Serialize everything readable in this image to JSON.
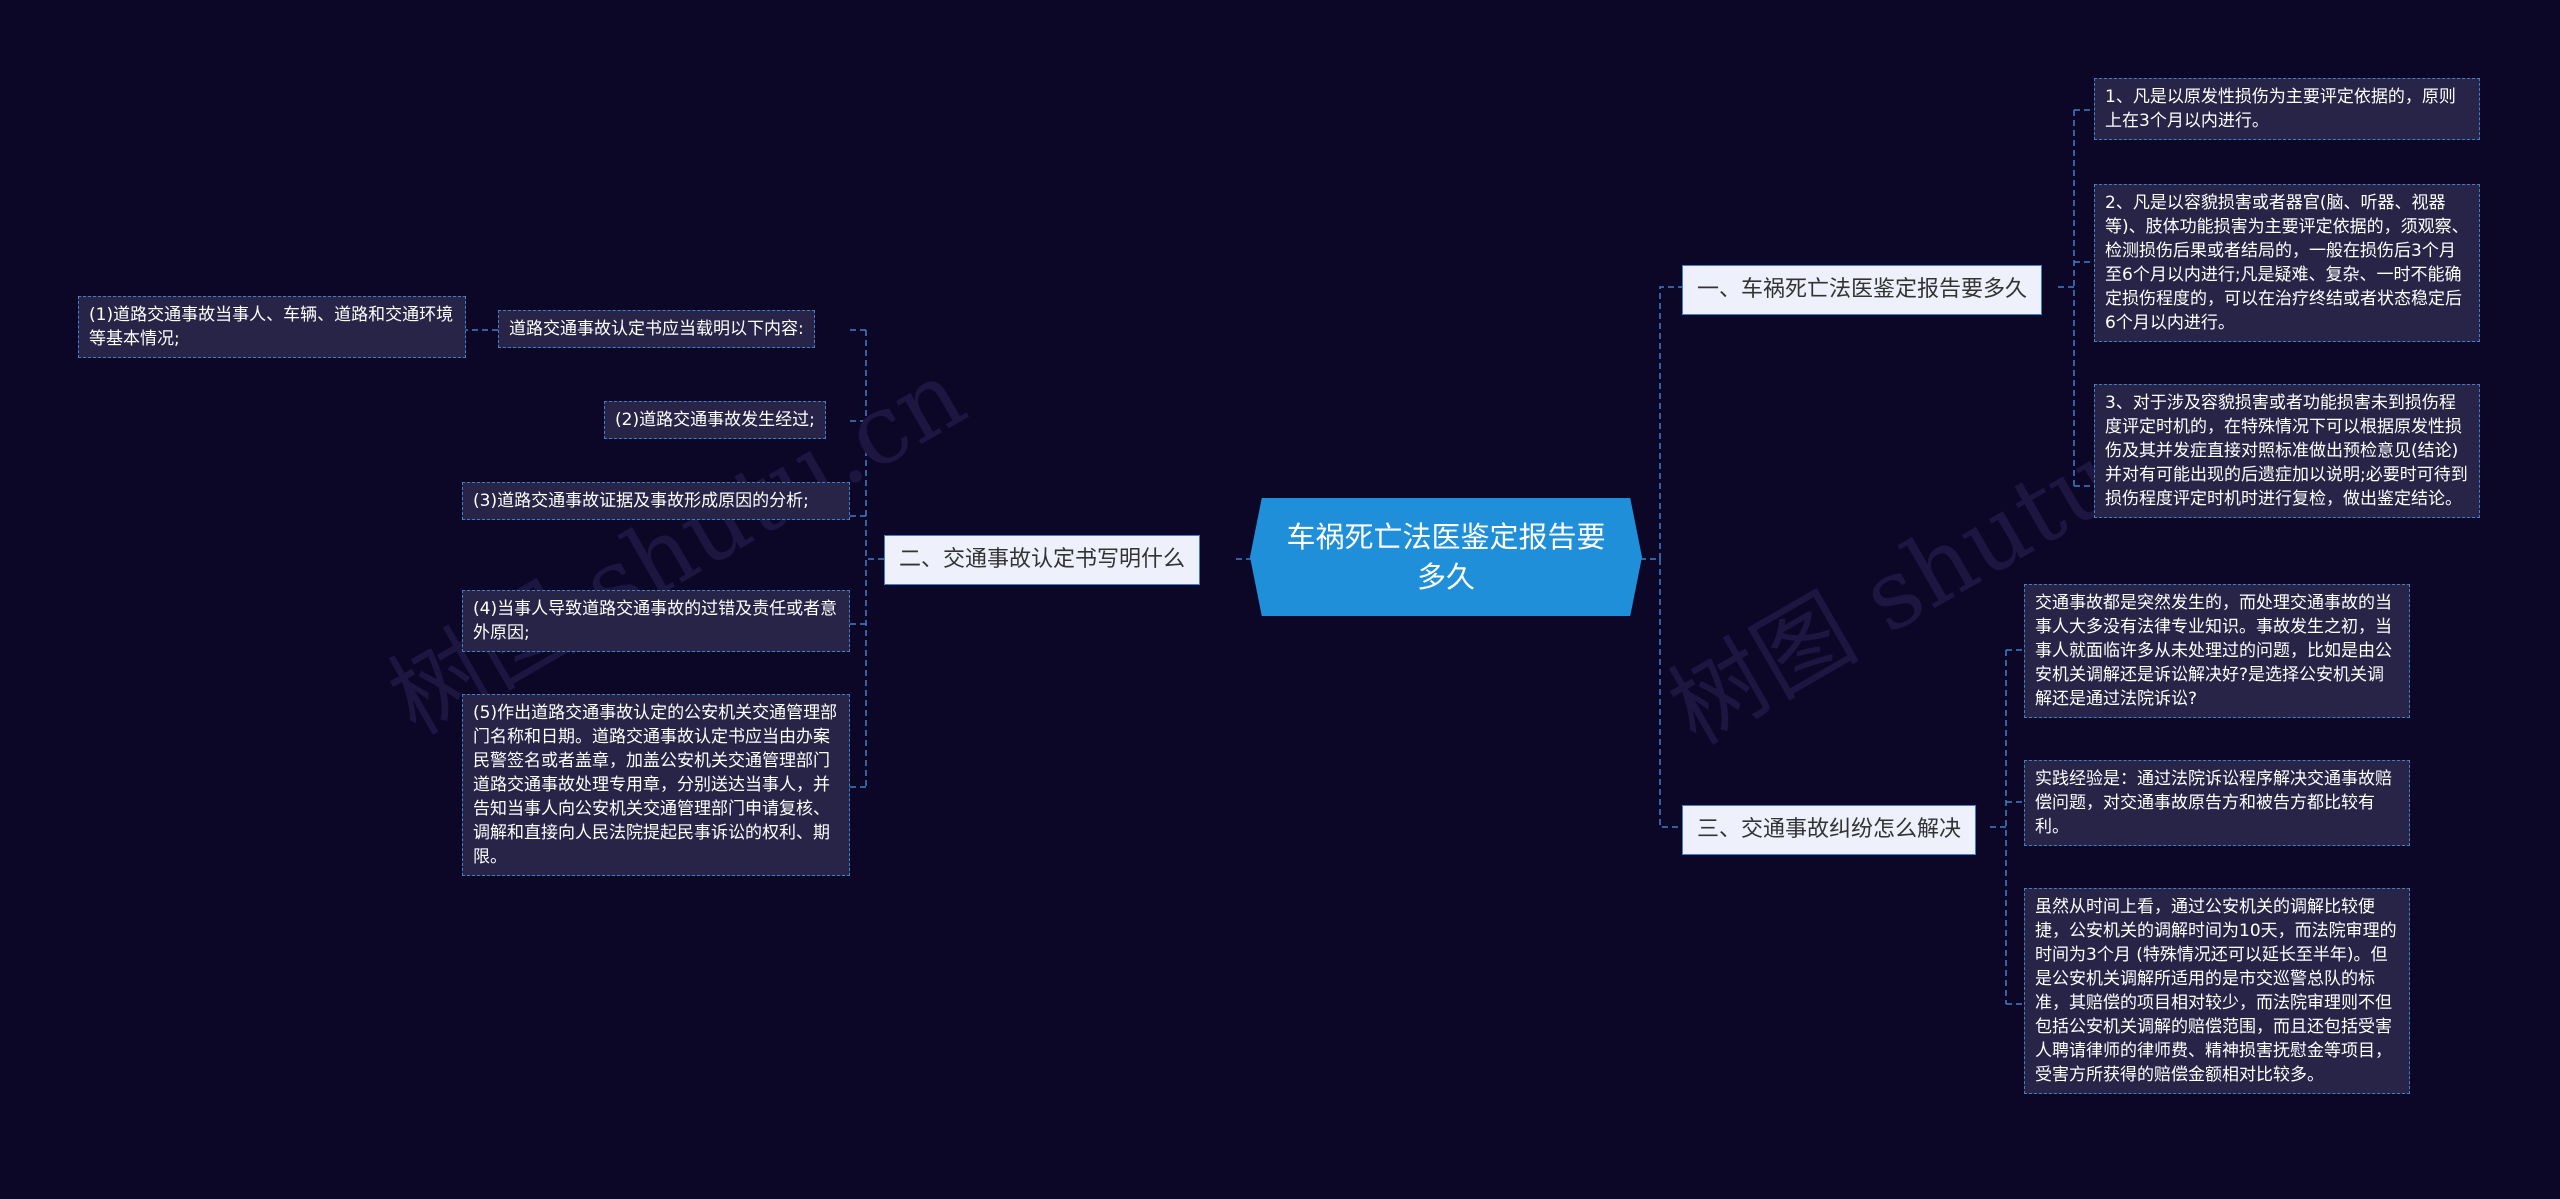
{
  "watermarks": [
    "树图 shutu.cn",
    "树图 shutu.cn"
  ],
  "root": {
    "label": "车祸死亡法医鉴定报告要多久"
  },
  "right_top": {
    "label": "一、车祸死亡法医鉴定报告要多久",
    "items": [
      "1、凡是以原发性损伤为主要评定依据的，原则上在3个月以内进行。",
      "2、凡是以容貌损害或者器官(脑、听器、视器等)、肢体功能损害为主要评定依据的，须观察、检测损伤后果或者结局的，一般在损伤后3个月至6个月以内进行;凡是疑难、复杂、一时不能确定损伤程度的，可以在治疗终结或者状态稳定后6个月以内进行。",
      "3、对于涉及容貌损害或者功能损害未到损伤程度评定时机的，在特殊情况下可以根据原发性损伤及其并发症直接对照标准做出预检意见(结论)并对有可能出现的后遗症加以说明;必要时可待到损伤程度评定时机时进行复检，做出鉴定结论。"
    ]
  },
  "right_bottom": {
    "label": "三、交通事故纠纷怎么解决",
    "items": [
      "交通事故都是突然发生的，而处理交通事故的当事人大多没有法律专业知识。事故发生之初，当事人就面临许多从未处理过的问题，比如是由公安机关调解还是诉讼解决好?是选择公安机关调解还是通过法院诉讼?",
      "实践经验是：通过法院诉讼程序解决交通事故赔偿问题，对交通事故原告方和被告方都比较有利。",
      "虽然从时间上看，通过公安机关的调解比较便捷，公安机关的调解时间为10天，而法院审理的时间为3个月 (特殊情况还可以延长至半年)。但是公安机关调解所适用的是市交巡警总队的标准，其赔偿的项目相对较少，而法院审理则不但包括公安机关调解的赔偿范围，而且还包括受害人聘请律师的律师费、精神损害抚慰金等项目，受害方所获得的赔偿金额相对比较多。"
    ]
  },
  "left": {
    "label": "二、交通事故认定书写明什么",
    "items": [
      "道路交通事故认定书应当载明以下内容:",
      "(2)道路交通事故发生经过;",
      "(3)道路交通事故证据及事故形成原因的分析;",
      "(4)当事人导致道路交通事故的过错及责任或者意外原因;",
      "(5)作出道路交通事故认定的公安机关交通管理部门名称和日期。道路交通事故认定书应当由办案民警签名或者盖章，加盖公安机关交通管理部门道路交通事故处理专用章，分别送达当事人，并告知当事人向公安机关交通管理部门申请复核、调解和直接向人民法院提起民事诉讼的权利、期限。"
    ],
    "sub_item": "(1)道路交通事故当事人、车辆、道路和交通环境等基本情况;"
  }
}
